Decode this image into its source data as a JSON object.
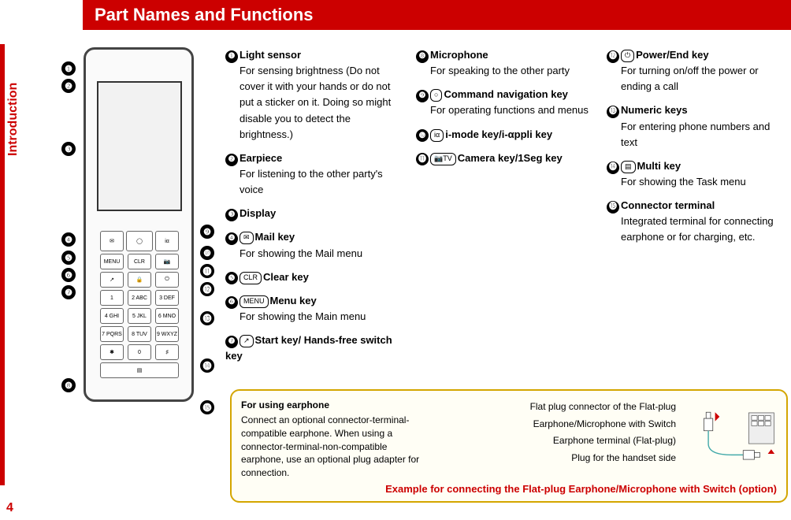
{
  "header": {
    "title": "Part Names and Functions"
  },
  "sidebar": {
    "section": "Introduction",
    "page": "4"
  },
  "callouts": [
    "❶",
    "❷",
    "❸",
    "❹",
    "❺",
    "❻",
    "❼",
    "❽",
    "❾",
    "❿",
    "⓫",
    "⓬",
    "⓭",
    "⓮",
    "⓯"
  ],
  "col1": [
    {
      "num": "❶",
      "icon": "",
      "name": "Light sensor",
      "desc": "For sensing brightness (Do not cover it with your hands or do not put a sticker on it. Doing so might disable you to detect the brightness.)"
    },
    {
      "num": "❷",
      "icon": "",
      "name": "Earpiece",
      "desc": "For listening to the other party's voice"
    },
    {
      "num": "❸",
      "icon": "",
      "name": "Display",
      "desc": ""
    },
    {
      "num": "❹",
      "icon": "✉",
      "name": "Mail key",
      "desc": "For showing the Mail menu"
    },
    {
      "num": "❺",
      "icon": "CLR",
      "name": "Clear key",
      "desc": ""
    },
    {
      "num": "❻",
      "icon": "MENU",
      "name": "Menu key",
      "desc": "For showing the Main menu"
    },
    {
      "num": "❼",
      "icon": "↗",
      "name": "Start key/ Hands-free switch key",
      "desc": ""
    }
  ],
  "col2": [
    {
      "num": "❽",
      "icon": "",
      "name": "Microphone",
      "desc": "For speaking to the other party"
    },
    {
      "num": "❾",
      "icon": "○",
      "name": "Command navigation key",
      "desc": "For operating functions and menus"
    },
    {
      "num": "❿",
      "icon": "iα",
      "name": "i-mode key/i-αppli key",
      "desc": ""
    },
    {
      "num": "⓫",
      "icon": "📷TV",
      "name": "Camera key/1Seg key",
      "desc": ""
    }
  ],
  "col3": [
    {
      "num": "⓬",
      "icon": "⏻",
      "name": "Power/End key",
      "desc": "For turning on/off the power or ending a call"
    },
    {
      "num": "⓭",
      "icon": "",
      "name": "Numeric keys",
      "desc": "For entering phone numbers and text"
    },
    {
      "num": "⓮",
      "icon": "▤",
      "name": "Multi key",
      "desc": "For showing the Task menu"
    },
    {
      "num": "⓯",
      "icon": "",
      "name": "Connector terminal",
      "desc": "Integrated terminal for connecting earphone or for charging, etc."
    }
  ],
  "earphone": {
    "heading": "For using earphone",
    "body": "Connect an optional connector-terminal-compatible earphone. When using a connector-terminal-non-compatible earphone, use an optional plug adapter for connection.",
    "label1": "Flat plug connector of the Flat-plug Earphone/Microphone with Switch",
    "label2": "Earphone terminal (Flat-plug)",
    "label3": "Plug for the handset side",
    "caption": "Example for connecting the Flat-plug Earphone/Microphone with Switch (option)"
  }
}
